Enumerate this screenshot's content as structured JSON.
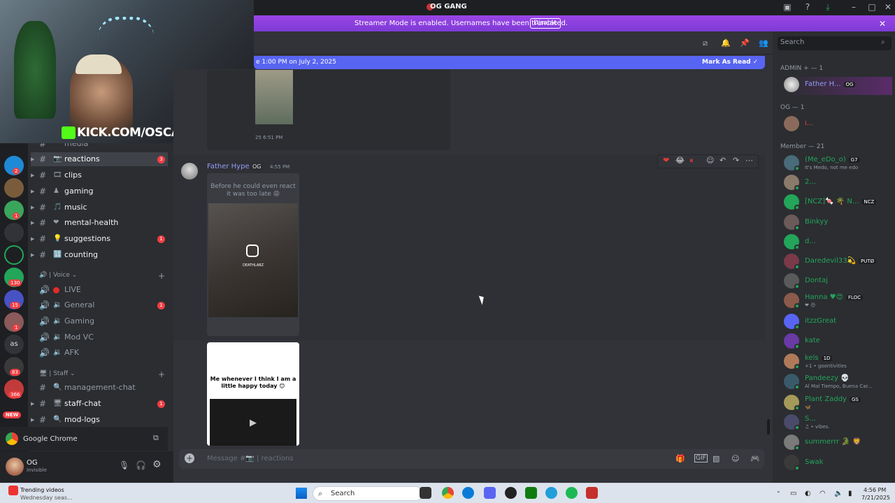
{
  "window": {
    "title": "OG GANG"
  },
  "banner": {
    "text": "Streamer Mode is enabled. Usernames have been truncated.",
    "disable_label": "Disable"
  },
  "webcam": {
    "overlay_text": "KICK.COM/OSCAR"
  },
  "servers": {
    "badges": [
      "5",
      "2",
      "1",
      "130",
      "15",
      "1",
      "83",
      "366"
    ],
    "text_icon": "as",
    "new_label": "NEW"
  },
  "channels": {
    "top_partial": "media",
    "text": [
      {
        "name": "reactions",
        "emoji": "📷",
        "badge": "3",
        "active": true
      },
      {
        "name": "clips",
        "emoji": "🎞",
        "badge": "",
        "unread": true
      },
      {
        "name": "gaming",
        "emoji": "♟",
        "badge": "",
        "unread": true
      },
      {
        "name": "music",
        "emoji": "🎵",
        "badge": "",
        "unread": true
      },
      {
        "name": "mental-health",
        "emoji": "❤",
        "badge": "",
        "unread": true
      },
      {
        "name": "suggestions",
        "emoji": "💡",
        "badge": "1",
        "unread": true
      },
      {
        "name": "counting",
        "emoji": "🔢",
        "badge": "",
        "unread": true
      }
    ],
    "voice_category": "Voice",
    "voice": [
      {
        "name": "LIVE",
        "badge": ""
      },
      {
        "name": "General",
        "badge": "1"
      },
      {
        "name": "Gaming",
        "badge": ""
      },
      {
        "name": "Mod VC",
        "badge": ""
      },
      {
        "name": "AFK",
        "badge": ""
      }
    ],
    "staff_category": "Staff",
    "staff": [
      {
        "name": "management-chat",
        "badge": "",
        "unread": false
      },
      {
        "name": "staff-chat",
        "badge": "1",
        "unread": true
      },
      {
        "name": "mod-logs",
        "badge": "",
        "unread": true
      }
    ]
  },
  "screen_share": {
    "app": "Google Chrome"
  },
  "user": {
    "name": "OG",
    "status": "Invisible"
  },
  "chat": {
    "new_messages": "e 1:00 PM on July 2, 2025",
    "mark_as_read": "Mark As Read",
    "prev_timestamp": "25 6:51 PM",
    "message": {
      "author": "Father Hype",
      "tag": "OG",
      "time": "4:55 PM",
      "caption1": "Before he could even react it was too late 😩",
      "ig_handle": "DEATHLABZ",
      "caption2": "Me whenever I think I am a little happy today 😊"
    },
    "composer_placeholder": "Message #📷 | reactions"
  },
  "members": {
    "search_placeholder": "Search",
    "groups": [
      {
        "label": "ADMIN + — 1",
        "items": [
          {
            "name": "Father H...",
            "tag": "OG",
            "color": "#949cf7",
            "sub": ""
          }
        ]
      },
      {
        "label": "OG — 1",
        "items": [
          {
            "name": "i...",
            "tag": "",
            "color": "#f23f43",
            "sub": ""
          }
        ]
      },
      {
        "label": "Member — 21",
        "items": [
          {
            "name": "(Me_eDo_o)",
            "tag": "G7",
            "color": "#23a55a",
            "sub": "It's Medo, not me edo"
          },
          {
            "name": "2...",
            "tag": "",
            "color": "#23a55a",
            "sub": ""
          },
          {
            "name": "[NCZ]🍬 🌴 N...",
            "tag": "NCZ",
            "color": "#23a55a",
            "sub": ""
          },
          {
            "name": "Binkyy",
            "tag": "",
            "color": "#23a55a",
            "sub": ""
          },
          {
            "name": "d...",
            "tag": "",
            "color": "#23a55a",
            "sub": ""
          },
          {
            "name": "Daredevil33💫",
            "tag": "PUTØ",
            "color": "#23a55a",
            "sub": ""
          },
          {
            "name": "Dontaj",
            "tag": "",
            "color": "#23a55a",
            "sub": ""
          },
          {
            "name": "Hanna ♥😍",
            "tag": "FLOC",
            "color": "#23a55a",
            "sub": "❤ 😍"
          },
          {
            "name": "itzzGreat",
            "tag": "",
            "color": "#23a55a",
            "sub": ""
          },
          {
            "name": "kate",
            "tag": "",
            "color": "#23a55a",
            "sub": ""
          },
          {
            "name": "kels",
            "tag": "1D",
            "color": "#23a55a",
            "sub": "+1 • goontivities"
          },
          {
            "name": "Pandeezy 💀",
            "tag": "",
            "color": "#23a55a",
            "sub": "Al Mal Tiempo, Buena Car..."
          },
          {
            "name": "Plant Zaddy",
            "tag": "GS",
            "color": "#23a55a",
            "sub": "🦋"
          },
          {
            "name": "S...",
            "tag": "",
            "color": "#23a55a",
            "sub": "♫ • vibes."
          },
          {
            "name": "summerrr 🐊 🦁",
            "tag": "",
            "color": "#23a55a",
            "sub": ""
          },
          {
            "name": "Swak",
            "tag": "",
            "color": "#23a55a",
            "sub": ""
          }
        ]
      }
    ]
  },
  "taskbar": {
    "widget_title": "Trending videos",
    "widget_sub": "Wednesday seas...",
    "search": "Search",
    "time": "4:56 PM",
    "date": "7/21/2025"
  },
  "colors": {
    "banner": "#9b45e6",
    "accent": "#5865f2",
    "online": "#23a55a",
    "danger": "#f23f43"
  }
}
